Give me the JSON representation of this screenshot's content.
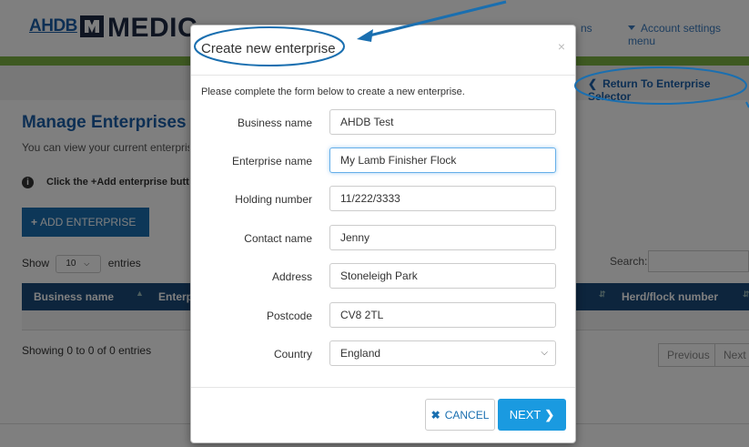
{
  "header": {
    "logo_small": "AHDB",
    "logo_main": "MEDIC",
    "nav_left": "ns",
    "nav_account": "Account settings menu"
  },
  "subheader": {
    "return_link": "Return To Enterprise Selector"
  },
  "main": {
    "title": "Manage Enterprises",
    "intro": "You can view your current enterprises",
    "hint_prefix": "Click the",
    "hint_button": "Add enterprise butt",
    "add_button": "ADD ENTERPRISE",
    "show_label": "Show",
    "show_value": "10",
    "entries_label": "entries",
    "search_label": "Search:",
    "table": {
      "columns": [
        "Business name",
        "Enterp",
        "Herd/flock number"
      ]
    },
    "showing": "Showing 0 to 0 of 0 entries",
    "pagination": {
      "previous": "Previous",
      "next": "Next"
    }
  },
  "modal": {
    "title": "Create new enterprise",
    "close": "×",
    "intro": "Please complete the form below to create a new enterprise.",
    "fields": [
      {
        "label": "Business name",
        "value": "AHDB Test"
      },
      {
        "label": "Enterprise name",
        "value": "My Lamb Finisher Flock"
      },
      {
        "label": "Holding number",
        "value": "11/222/3333"
      },
      {
        "label": "Contact name",
        "value": "Jenny"
      },
      {
        "label": "Address",
        "value": "Stoneleigh Park"
      },
      {
        "label": "Postcode",
        "value": "CV8 2TL"
      }
    ],
    "country": {
      "label": "Country",
      "value": "England"
    },
    "cancel_label": "CANCEL",
    "next_label": "NEXT"
  },
  "icons": {
    "info": "info-icon",
    "plus": "plus-icon",
    "close": "close-icon",
    "chevron_left": "chevron-left-icon",
    "chevron_right": "chevron-right-icon",
    "chevron_down": "chevron-down-icon",
    "cancel_x": "x-icon"
  },
  "colors": {
    "brand_blue": "#1a5fa8",
    "green_bar": "#7db343",
    "next_button": "#1a9ae0",
    "annotation": "#1a6fb0"
  }
}
